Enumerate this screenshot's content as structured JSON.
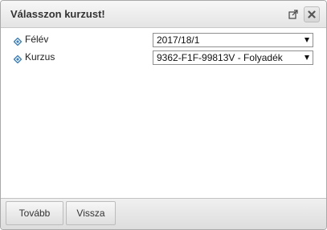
{
  "dialog": {
    "title": "Válasszon kurzust!",
    "icons": {
      "popout": "popout-icon",
      "close": "close-icon"
    }
  },
  "form": {
    "semester": {
      "label": "Félév",
      "value": "2017/18/1"
    },
    "course": {
      "label": "Kurzus",
      "value": "9362-F1F-99813V - Folyadék"
    }
  },
  "footer": {
    "next_label": "Tovább",
    "back_label": "Vissza"
  },
  "colors": {
    "bullet": "#3b7fc4",
    "titlebar": "#e9e9e9",
    "footer": "#e4e4e4"
  }
}
